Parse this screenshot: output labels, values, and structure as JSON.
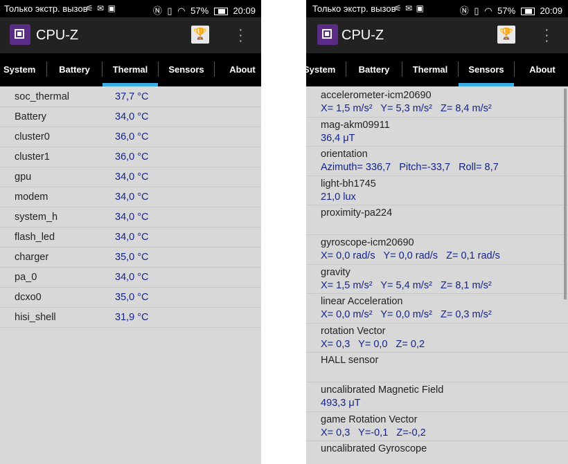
{
  "status_bar": {
    "carrier_text": "Только экстр. вызов",
    "battery": "57%",
    "time": "20:09"
  },
  "app": {
    "title": "CPU-Z"
  },
  "icons": {
    "logo": "cpu-chip-icon",
    "trophy": "trophy-icon",
    "menu": "more-vert-icon"
  },
  "colors": {
    "tab_indicator": "#3aaee4",
    "value_text": "#13238c",
    "app_logo": "#5b2c86"
  },
  "left_screen": {
    "tabs": [
      {
        "label": "System"
      },
      {
        "label": "Battery"
      },
      {
        "label": "Thermal"
      },
      {
        "label": "Sensors"
      },
      {
        "label": "About"
      }
    ],
    "active_tab": "Thermal",
    "thermal": [
      {
        "name": "soc_thermal",
        "value": "37,7 °C"
      },
      {
        "name": "Battery",
        "value": "34,0 °C"
      },
      {
        "name": "cluster0",
        "value": "36,0 °C"
      },
      {
        "name": "cluster1",
        "value": "36,0 °C"
      },
      {
        "name": "gpu",
        "value": "34,0 °C"
      },
      {
        "name": "modem",
        "value": "34,0 °C"
      },
      {
        "name": "system_h",
        "value": "34,0 °C"
      },
      {
        "name": "flash_led",
        "value": "34,0 °C"
      },
      {
        "name": "charger",
        "value": "35,0 °C"
      },
      {
        "name": "pa_0",
        "value": "34,0 °C"
      },
      {
        "name": "dcxo0",
        "value": "35,0 °C"
      },
      {
        "name": "hisi_shell",
        "value": "31,9 °C"
      }
    ]
  },
  "right_screen": {
    "tabs": [
      {
        "label": "System"
      },
      {
        "label": "Battery"
      },
      {
        "label": "Thermal"
      },
      {
        "label": "Sensors"
      },
      {
        "label": "About"
      }
    ],
    "active_tab": "Sensors",
    "sensors": [
      {
        "name": "accelerometer-icm20690",
        "value": "X= 1,5 m/s²   Y= 5,3 m/s²   Z= 8,4 m/s²"
      },
      {
        "name": "mag-akm09911",
        "value": "36,4 μT"
      },
      {
        "name": "orientation",
        "value": "Azimuth= 336,7   Pitch=-33,7   Roll= 8,7"
      },
      {
        "name": "light-bh1745",
        "value": "21,0 lux"
      },
      {
        "name": "proximity-pa224",
        "value": ""
      },
      {
        "name": "gyroscope-icm20690",
        "value": "X= 0,0 rad/s   Y= 0,0 rad/s   Z= 0,1 rad/s"
      },
      {
        "name": "gravity",
        "value": "X= 1,5 m/s²   Y= 5,4 m/s²   Z= 8,1 m/s²"
      },
      {
        "name": "linear Acceleration",
        "value": "X= 0,0 m/s²   Y= 0,0 m/s²   Z= 0,3 m/s²"
      },
      {
        "name": "rotation Vector",
        "value": "X= 0,3   Y= 0,0   Z= 0,2"
      },
      {
        "name": "HALL sensor",
        "value": ""
      },
      {
        "name": "uncalibrated Magnetic Field",
        "value": "493,3 μT"
      },
      {
        "name": "game Rotation Vector",
        "value": "X= 0,3   Y=-0,1   Z=-0,2"
      },
      {
        "name": "uncalibrated Gyroscope",
        "value": ""
      }
    ]
  }
}
